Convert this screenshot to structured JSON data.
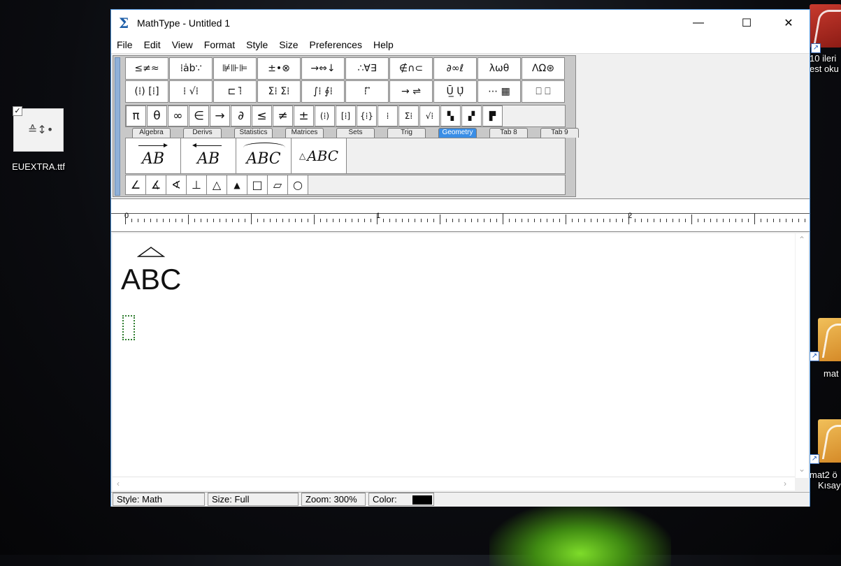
{
  "desktop": {
    "file_icon_label": "EUEXTRA.ttf",
    "right_icons": [
      "10 ileri",
      "est oku",
      "mat",
      "mat2 ö",
      "Kısay"
    ]
  },
  "window": {
    "title": "MathType - Untitled 1",
    "controls": {
      "minimize": "—",
      "maximize": "☐",
      "close": "✕"
    }
  },
  "menu": [
    "File",
    "Edit",
    "View",
    "Format",
    "Style",
    "Size",
    "Preferences",
    "Help"
  ],
  "palette": {
    "row1": [
      "≤≠≈",
      "⁞ȧb∵",
      "⊯⊪⊫",
      "±•⊗",
      "→⇔↓",
      "∴∀∃",
      "∉∩⊂",
      "∂∞ℓ",
      "λωθ",
      "ΛΩ⊛"
    ],
    "row2": [
      "(⁞) [⁞]",
      "⁞ √⁞",
      "⊏ ⁞̄",
      "Σ⁞ Σ⁞",
      "∫⁞ ∮⁞",
      "⁞ ⃡",
      "→ ⇌",
      "Ū̲ Ụ̇",
      "⋯ ▦",
      "⎕ ⎕"
    ],
    "symbols": [
      "π",
      "θ",
      "∞",
      "∈",
      "→",
      "∂",
      "≤",
      "≠",
      "±",
      "(⁞)",
      "[⁞]",
      "{⁞}",
      "⁞",
      "Σ⁞",
      "√⁞",
      "▚",
      "▞",
      "▛"
    ],
    "tabs": [
      "Algebra",
      "Derivs",
      "Statistics",
      "Matrices",
      "Sets",
      "Trig",
      "Geometry",
      "Tab 8",
      "Tab 9"
    ],
    "active_tab": "Geometry",
    "geometry_templates": [
      "AB",
      "AB",
      "ABC",
      "ABC"
    ],
    "geometry_prefix_symbol": "△",
    "shapes": [
      "∠",
      "∡",
      "∢",
      "⊥",
      "△",
      "▲",
      "□",
      "▱",
      "○"
    ],
    "small_tools": [
      "⇧",
      "↑",
      "↑",
      "↑",
      "↑"
    ]
  },
  "ruler": {
    "labels": [
      "0",
      "1",
      "2"
    ]
  },
  "editor": {
    "content": "ABC"
  },
  "status": {
    "style": "Style: Math",
    "size": "Size: Full",
    "zoom": "Zoom: 300%",
    "color_label": "Color:",
    "color_value": "#000000"
  }
}
